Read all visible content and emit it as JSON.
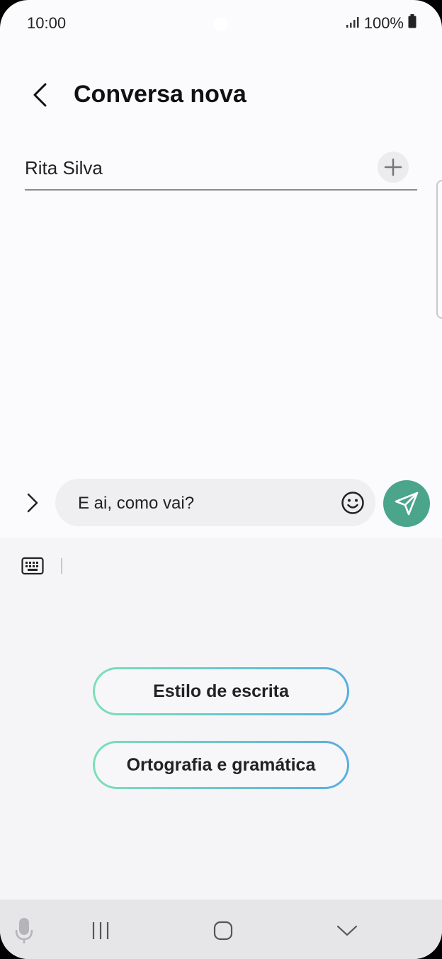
{
  "status_bar": {
    "time": "10:00",
    "battery": "100%"
  },
  "header": {
    "title": "Conversa nova"
  },
  "recipient": {
    "name": "Rita Silva"
  },
  "composer": {
    "message": "E ai, como vai?"
  },
  "ai_options": [
    {
      "label": "Estilo de escrita"
    },
    {
      "label": "Ortografia e gramática"
    }
  ],
  "colors": {
    "send_button": "#4aa58a",
    "gradient_start": "#7de0b5",
    "gradient_end": "#5aaee0"
  },
  "icons": [
    "signal-icon",
    "battery-icon",
    "back-icon",
    "add-icon",
    "chevron-right-icon",
    "emoji-icon",
    "send-icon",
    "keyboard-icon",
    "mic-icon",
    "recents-icon",
    "home-icon",
    "hide-keyboard-icon"
  ]
}
